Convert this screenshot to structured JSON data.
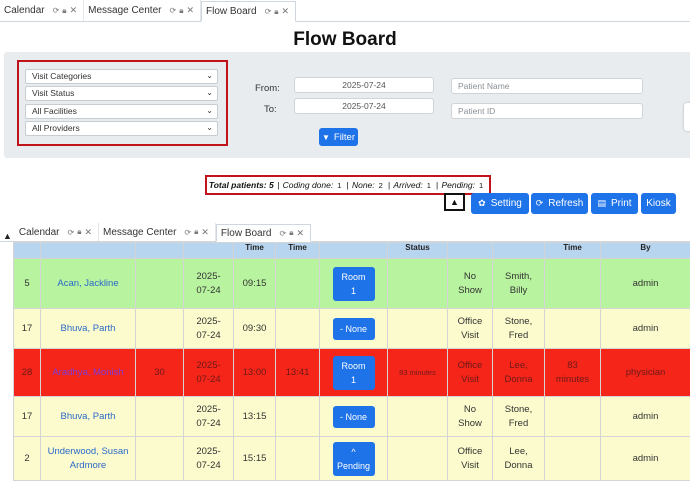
{
  "tabs_top": {
    "items": [
      {
        "label": "Calendar"
      },
      {
        "label": "Message Center"
      },
      {
        "label": "Flow Board"
      }
    ]
  },
  "page": {
    "title": "Flow Board"
  },
  "filters": {
    "selects": [
      "Visit Categories",
      "Visit Status",
      "All Facilities",
      "All Providers"
    ],
    "from_label": "From:",
    "to_label": "To:",
    "from_value": "2025-07-24",
    "to_value": "2025-07-24",
    "patient_name_placeholder": "Patient Name",
    "patient_id_placeholder": "Patient ID",
    "filter_button": "Filter"
  },
  "summary": {
    "total_label": "Total patients:",
    "total_value": "5",
    "coding_label": "Coding done:",
    "coding_value": "1",
    "none_label": "None:",
    "none_value": "2",
    "arrived_label": "Arrived:",
    "arrived_value": "1",
    "pending_label": "Pending:",
    "pending_value": "1"
  },
  "actions": {
    "setting": "Setting",
    "refresh": "Refresh",
    "print": "Print",
    "kiosk": "Kiosk"
  },
  "tabs_second": {
    "items": [
      {
        "label": "Calendar"
      },
      {
        "label": "Message Center"
      },
      {
        "label": "Flow Board"
      }
    ]
  },
  "table": {
    "headers": [
      "",
      "",
      "",
      "",
      "Time",
      "Time",
      "",
      "Status",
      "",
      "",
      "Time",
      "By"
    ],
    "rows": [
      {
        "tone": "green",
        "c0": "5",
        "name": "Acan, Jackline",
        "c2": "",
        "date": "2025-\n07-24",
        "time1": "09:15",
        "time2": "",
        "btn": "Room\n1",
        "status": "",
        "visit": "No\nShow",
        "provider": "Smith,\nBilly",
        "elapsed": "",
        "by": "admin"
      },
      {
        "tone": "yellow",
        "c0": "17",
        "name": "Bhuva, Parth",
        "c2": "",
        "date": "2025-\n07-24",
        "time1": "09:30",
        "time2": "",
        "btn": "- None",
        "status": "",
        "visit": "Office\nVisit",
        "provider": "Stone,\nFred",
        "elapsed": "",
        "by": "admin"
      },
      {
        "tone": "red",
        "c0": "28",
        "name": "Aradhya, Monish",
        "c2": "30",
        "date": "2025-\n07-24",
        "time1": "13:00",
        "time2": "13:41",
        "btn": "Room\n1",
        "status": "83 minutes",
        "visit": "Office\nVisit",
        "provider": "Lee,\nDonna",
        "elapsed": "83\nminutes",
        "by": "physician"
      },
      {
        "tone": "yellow",
        "c0": "17",
        "name": "Bhuva, Parth",
        "c2": "",
        "date": "2025-\n07-24",
        "time1": "13:15",
        "time2": "",
        "btn": "- None",
        "status": "",
        "visit": "No\nShow",
        "provider": "Stone,\nFred",
        "elapsed": "",
        "by": "admin"
      },
      {
        "tone": "yellow",
        "c0": "2",
        "name": "Underwood, Susan\nArdmore",
        "c2": "",
        "date": "2025-\n07-24",
        "time1": "15:15",
        "time2": "",
        "btn": "^\nPending",
        "status": "",
        "visit": "Office\nVisit",
        "provider": "Lee,\nDonna",
        "elapsed": "",
        "by": "admin"
      }
    ]
  },
  "colors": {
    "accent": "#1e73e8",
    "header_bg": "#b8d5f0",
    "row_green": "#b8f39f",
    "row_yellow": "#fbfbcd",
    "row_red": "#f62519",
    "highlight_border": "#c0141c"
  }
}
